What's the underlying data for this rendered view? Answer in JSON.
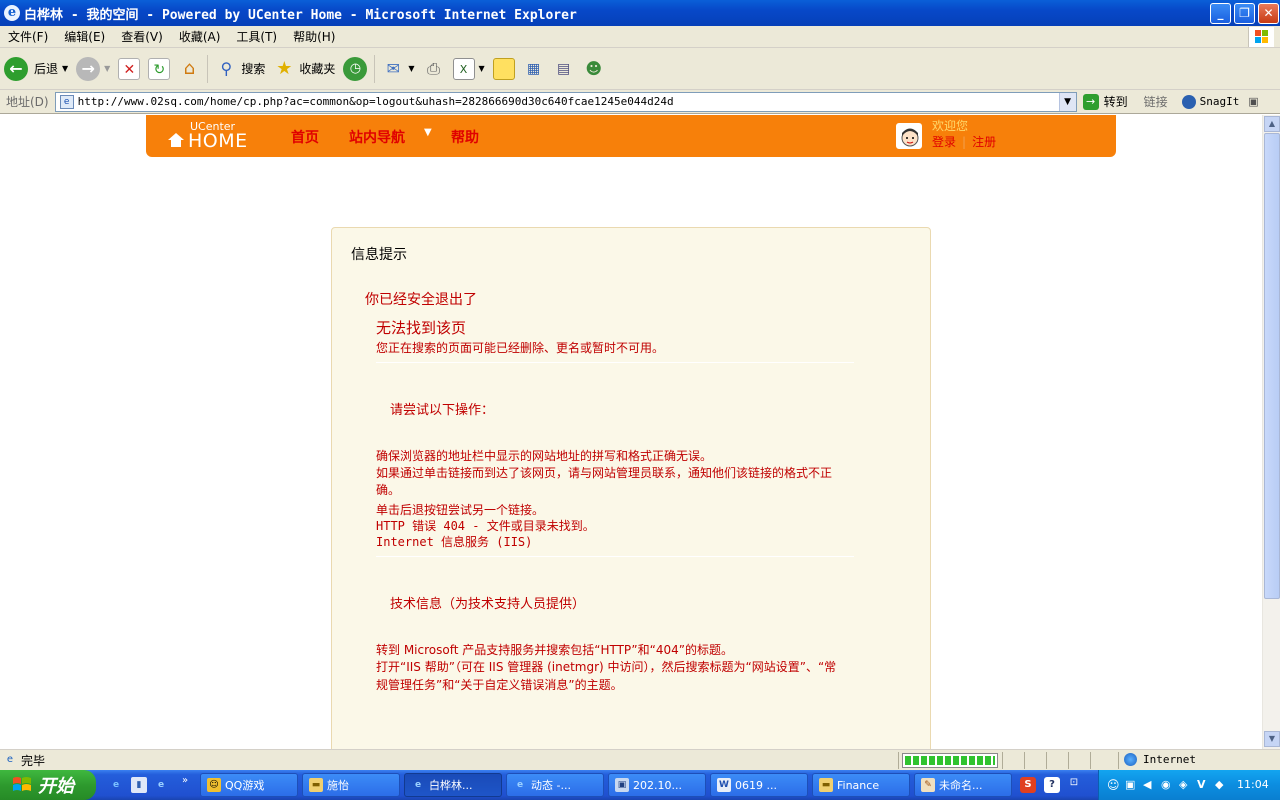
{
  "window": {
    "title": "白桦林 - 我的空间 - Powered by UCenter Home - Microsoft Internet Explorer",
    "controls": {
      "minimize": "_",
      "maximize": "❐",
      "close": "✕"
    }
  },
  "menubar": {
    "items": [
      "文件(F)",
      "编辑(E)",
      "查看(V)",
      "收藏(A)",
      "工具(T)",
      "帮助(H)"
    ]
  },
  "toolbar": {
    "back_label": "后退",
    "search_label": "搜索",
    "favorites_label": "收藏夹"
  },
  "addressbar": {
    "label": "地址(D)",
    "url": "http://www.02sq.com/home/cp.php?ac=common&op=logout&uhash=282866690d30c640fcae1245e044d24d",
    "go_label": "转到",
    "links_label": "链接",
    "snagit_label": "SnagIt"
  },
  "uchome": {
    "logo_top": "UCenter",
    "logo_main": "HOME",
    "nav": {
      "home": "首页",
      "site_nav": "站内导航",
      "help": "帮助"
    },
    "welcome": "欢迎您",
    "login": "登录",
    "register": "注册"
  },
  "message": {
    "header": "信息提示",
    "logout_text": "你已经安全退出了",
    "error_title": "无法找到该页",
    "error_subtitle": "您正在搜索的页面可能已经删除、更名或暂时不可用。",
    "try_heading": "请尝试以下操作：",
    "try_items": [
      "确保浏览器的地址栏中显示的网站地址的拼写和格式正确无误。",
      "如果通过单击链接而到达了该网页，请与网站管理员联系，通知他们该链接的格式不正确。",
      "单击后退按钮尝试另一个链接。"
    ],
    "http_error": "HTTP 错误 404 - 文件或目录未找到。",
    "iis": "Internet 信息服务 (IIS)",
    "tech_heading": "技术信息（为技术支持人员提供）",
    "tech_items": [
      "转到 Microsoft 产品支持服务并搜索包括“HTTP”和“404”的标题。",
      "打开“IIS 帮助”（可在 IIS 管理器 (inetmgr) 中访问），然后搜索标题为“网站设置”、“常规管理任务”和“关于自定义错误消息”的主题。"
    ]
  },
  "statusbar": {
    "status": "完毕",
    "zone": "Internet",
    "progress_fraction": 1.0
  },
  "taskbar": {
    "start_label": "开始",
    "tasks": [
      {
        "label": "QQ游戏",
        "icon": "qq-icon",
        "active": false
      },
      {
        "label": "施怡",
        "icon": "folder-icon",
        "active": false
      },
      {
        "label": "白桦林...",
        "icon": "ie-icon",
        "active": true
      },
      {
        "label": "动态 -...",
        "icon": "ie-icon",
        "active": false
      },
      {
        "label": "202.10...",
        "icon": "network-icon",
        "active": false
      },
      {
        "label": "0619 ...",
        "icon": "word-icon",
        "active": false
      },
      {
        "label": "Finance",
        "icon": "folder-icon",
        "active": false
      },
      {
        "label": "未命名...",
        "icon": "paint-icon",
        "active": false
      }
    ],
    "clock": "11:04"
  },
  "colors": {
    "uc_orange": "#f7800a",
    "error_red": "#c00000",
    "msg_bg": "#fbf8e8",
    "xp_blue": "#245edb",
    "start_green": "#2e9a2e"
  }
}
